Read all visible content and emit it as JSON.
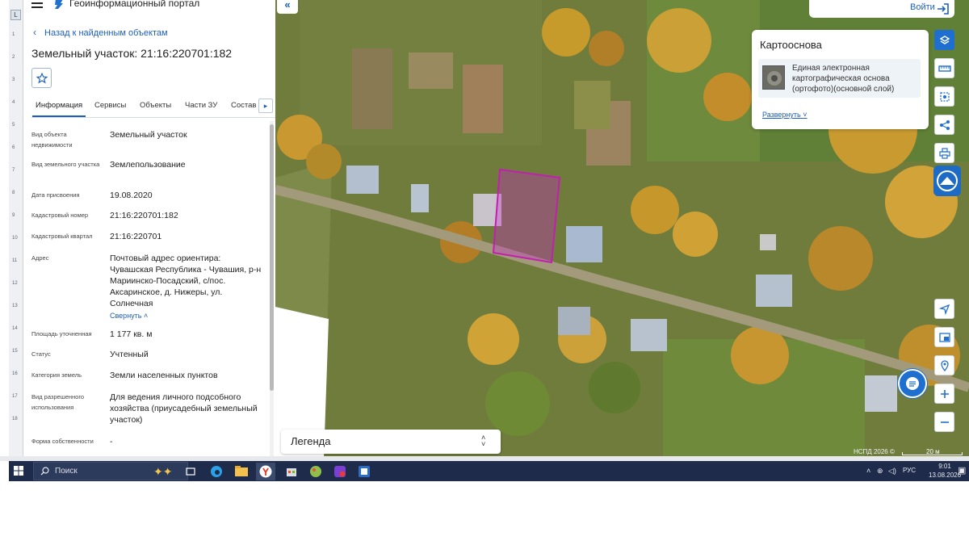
{
  "app": {
    "title": "Геоинформационный портал"
  },
  "nav": {
    "back_label": "Назад к найденным объектам"
  },
  "object": {
    "title": "Земельный участок: 21:16:220701:182"
  },
  "tabs": [
    {
      "label": "Информация",
      "active": true
    },
    {
      "label": "Сервисы"
    },
    {
      "label": "Объекты"
    },
    {
      "label": "Части ЗУ"
    },
    {
      "label": "Состав"
    }
  ],
  "properties": [
    {
      "key": "Вид объекта недвижимости",
      "value": "Земельный участок"
    },
    {
      "key": "Вид земельного участка",
      "value": "Землепользование"
    },
    {
      "key": "Дата присвоения",
      "value": "19.08.2020"
    },
    {
      "key": "Кадастровый номер",
      "value": "21:16:220701:182"
    },
    {
      "key": "Кадастровый квартал",
      "value": "21:16:220701"
    },
    {
      "key": "Адрес",
      "value": "Почтовый адрес ориентира: Чувашская Республика - Чувашия, р-н Мариинско-Посадский, с/пос. Аксаринское, д. Нижеры, ул. Солнечная",
      "collapse_label": "Свернуть"
    },
    {
      "key": "Площадь уточненная",
      "value": "1 177 кв. м"
    },
    {
      "key": "Статус",
      "value": "Учтенный"
    },
    {
      "key": "Категория земель",
      "value": "Земли населенных пунктов"
    },
    {
      "key": "Вид разрешенного использования",
      "value": "Для ведения личного подсобного хозяйства (приусадебный земельный участок)"
    },
    {
      "key": "Форма собственности",
      "value": "-"
    }
  ],
  "header_right": {
    "login_label": "Войти"
  },
  "basemap": {
    "title": "Картооснова",
    "layer_name": "Единая электронная картографическая основа (ортофото)(основной слой)",
    "expand_label": "Развернуть"
  },
  "legend": {
    "label": "Легенда"
  },
  "attribution": {
    "text": "НСПД 2026 ©",
    "scale": "20 м"
  },
  "ruler": {
    "ticks": [
      "1",
      "2",
      "3",
      "4",
      "5",
      "6",
      "7",
      "8",
      "9",
      "10",
      "11",
      "12",
      "13",
      "14",
      "15",
      "16",
      "17",
      "18"
    ]
  },
  "taskbar": {
    "search_placeholder": "Поиск",
    "lang": "РУС",
    "time": "9:01",
    "date": "13.08.2026"
  },
  "colors": {
    "accent": "#1f6fd0",
    "link": "#1f5fb8",
    "parcel_outline": "#c21fb0",
    "taskbar": "#1f2b4a"
  }
}
